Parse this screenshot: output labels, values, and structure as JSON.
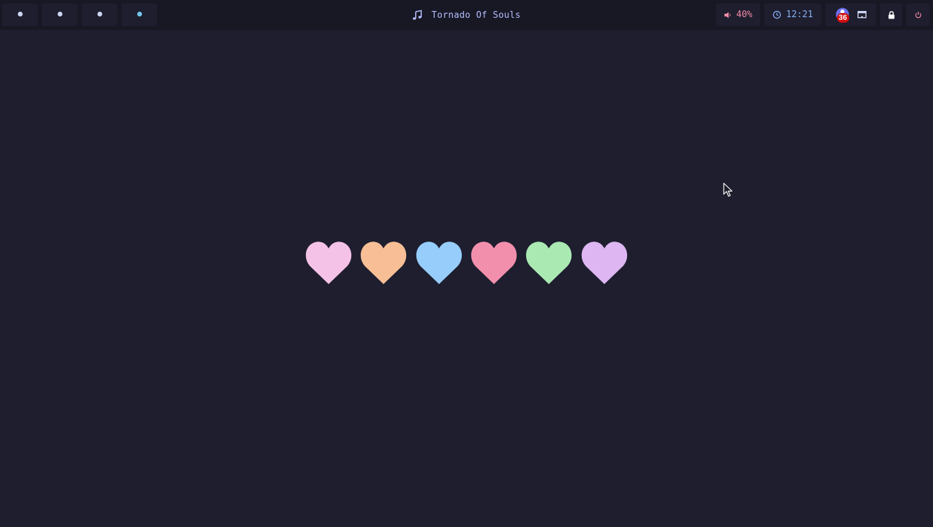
{
  "workspaces": [
    {
      "name": "workspace-1",
      "color": "#cdd6f4"
    },
    {
      "name": "workspace-2",
      "color": "#cdd6f4"
    },
    {
      "name": "workspace-3",
      "color": "#cdd6f4"
    },
    {
      "name": "workspace-4",
      "color": "#74c7ec"
    }
  ],
  "now_playing": {
    "title": "Tornado Of Souls",
    "icon": "music-note-icon"
  },
  "volume": {
    "label": "40%",
    "icon": "speaker-icon",
    "color": "#f38ba8"
  },
  "clock": {
    "time": "12:21",
    "icon": "clock-icon",
    "color": "#89b4fa"
  },
  "tray": {
    "badge": "36",
    "icons": [
      "notification-app-icon",
      "display-icon"
    ]
  },
  "lock": {
    "icon": "lock-icon"
  },
  "power": {
    "icon": "power-icon",
    "color": "#f38ba8"
  },
  "hearts": [
    "#f5c2e7",
    "#fab387",
    "#89c4fa",
    "#f38ba8",
    "#a6e3a1",
    "#cba6f7"
  ]
}
